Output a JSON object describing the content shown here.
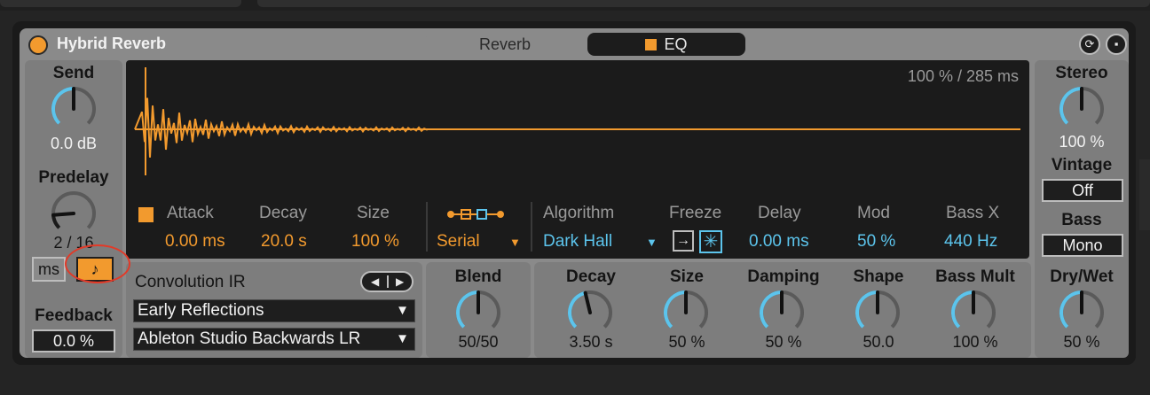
{
  "device": {
    "title": "Hybrid Reverb",
    "tabs": [
      {
        "label": "Reverb",
        "active": true
      },
      {
        "label": "EQ",
        "active": false
      }
    ]
  },
  "left": {
    "send": {
      "label": "Send",
      "value": "0.0 dB",
      "level": 0.5
    },
    "predelay": {
      "label": "Predelay",
      "value": "2  /  16",
      "level": 0.15
    },
    "unit_ms": "ms",
    "unit_note": "♪",
    "feedback": {
      "label": "Feedback",
      "value": "0.0 %"
    }
  },
  "display": {
    "readout": "100 %  /  285 ms",
    "attack": {
      "label": "Attack",
      "value": "0.00 ms"
    },
    "decay": {
      "label": "Decay",
      "value": "20.0 s"
    },
    "size": {
      "label": "Size",
      "value": "100 %"
    },
    "routing": {
      "value": "Serial"
    },
    "algorithm": {
      "label": "Algorithm",
      "value": "Dark Hall"
    },
    "freeze": {
      "label": "Freeze"
    },
    "delay": {
      "label": "Delay",
      "value": "0.00 ms"
    },
    "mod": {
      "label": "Mod",
      "value": "50 %"
    },
    "bassx": {
      "label": "Bass X",
      "value": "440 Hz"
    }
  },
  "convolution": {
    "label": "Convolution IR",
    "category": "Early Reflections",
    "ir": "Ableton Studio Backwards LR"
  },
  "blend": {
    "label": "Blend",
    "value": "50/50",
    "level": 0.5
  },
  "algo_knobs": [
    {
      "label": "Decay",
      "value": "3.50 s",
      "level": 0.45
    },
    {
      "label": "Size",
      "value": "50 %",
      "level": 0.5
    },
    {
      "label": "Damping",
      "value": "50 %",
      "level": 0.5
    },
    {
      "label": "Shape",
      "value": "50.0",
      "level": 0.5
    },
    {
      "label": "Bass Mult",
      "value": "100 %",
      "level": 0.5
    }
  ],
  "right": {
    "stereo": {
      "label": "Stereo",
      "value": "100 %",
      "level": 0.5
    },
    "vintage": {
      "label": "Vintage",
      "value": "Off"
    },
    "bass": {
      "label": "Bass",
      "value": "Mono"
    },
    "drywet": {
      "label": "Dry/Wet",
      "value": "50 %",
      "level": 0.5
    }
  },
  "colors": {
    "accent": "#f29a2e",
    "blue": "#5cc4ec",
    "knob_arc": "#5cc4ec"
  }
}
